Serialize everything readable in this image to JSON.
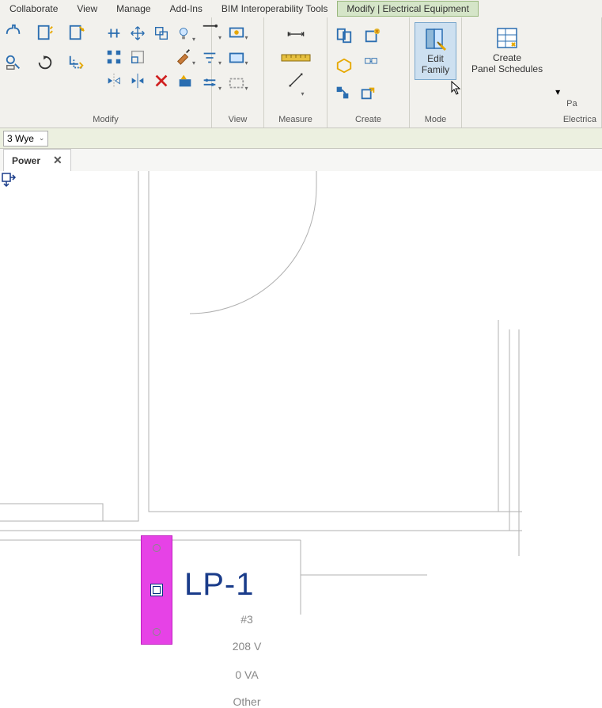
{
  "menubar": {
    "items": [
      "Collaborate",
      "View",
      "Manage",
      "Add-Ins",
      "BIM Interoperability Tools",
      "Modify | Electrical Equipment"
    ],
    "active_index": 5
  },
  "ribbon": {
    "panels": {
      "modify": {
        "label": "Modify"
      },
      "view": {
        "label": "View"
      },
      "measure": {
        "label": "Measure"
      },
      "create": {
        "label": "Create"
      },
      "mode": {
        "label": "Mode",
        "edit_family": "Edit\nFamily"
      },
      "electrical": {
        "label": "Electrica",
        "create_panel_schedules": "Create\nPanel Schedules"
      },
      "extra": {
        "label": "Pa"
      }
    }
  },
  "type_selector": {
    "value": "3 Wye"
  },
  "view_tab": {
    "title": "Power",
    "close": "✕"
  },
  "equipment": {
    "tag": "LP-1",
    "info1": "#3",
    "info2": "208 V",
    "info3": "0 VA",
    "info4": "Other"
  },
  "icons": {
    "modify_small": [
      "cope-icon",
      "cut-icon",
      "trim-icon",
      "paste-icon",
      "join-icon",
      "split-icon",
      "cycle-icon",
      "rotate-icon",
      "offset-icon"
    ],
    "modify_grid": [
      "align-icon",
      "move-icon",
      "copy-icon",
      "light-icon",
      "array-icon",
      "grid-icon",
      "blank-icon",
      "paint-icon",
      "mirror-icon",
      "flip-icon",
      "delete-icon",
      "demolish-icon"
    ]
  }
}
